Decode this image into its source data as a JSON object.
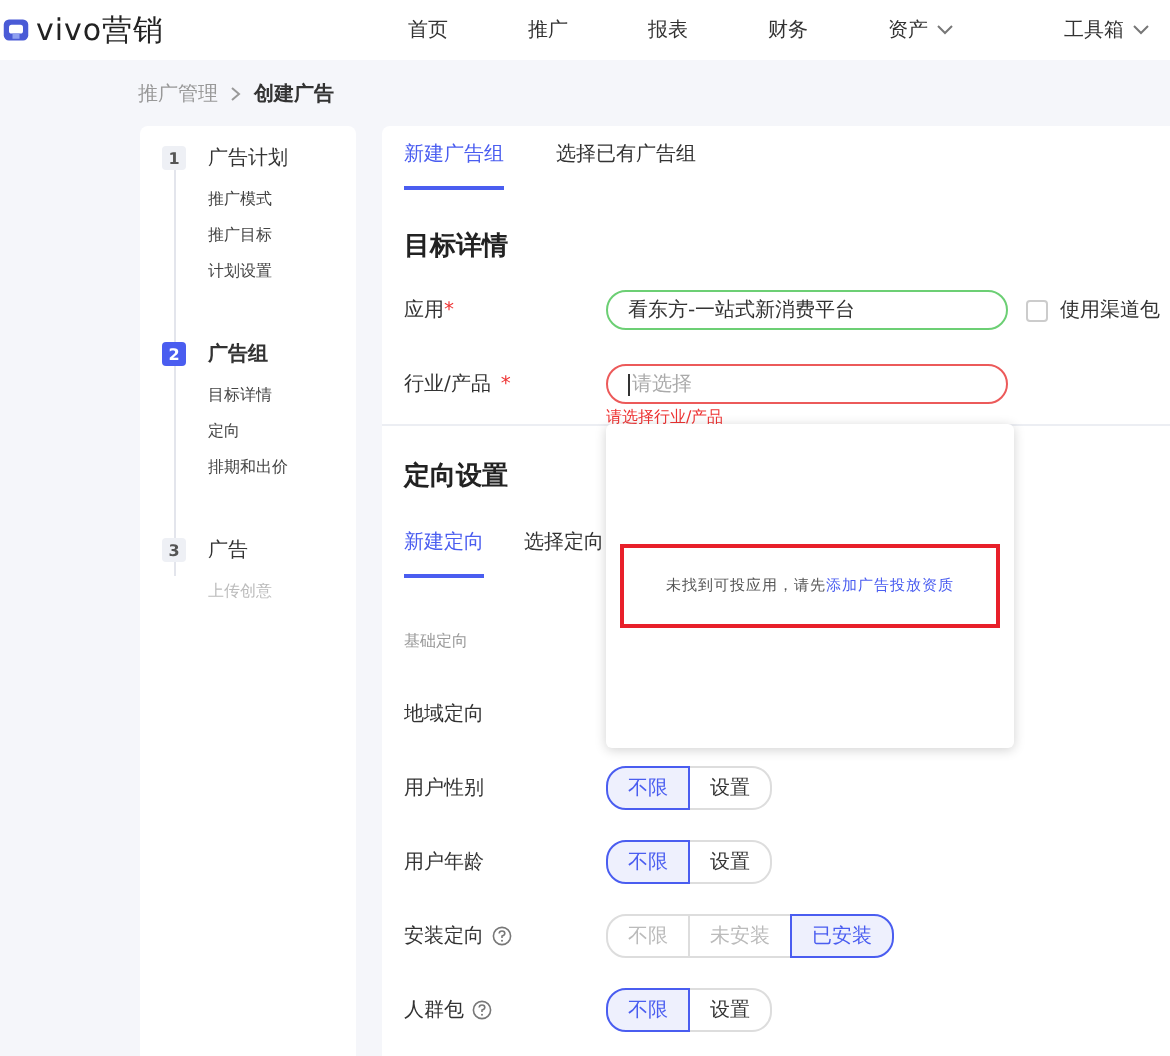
{
  "header": {
    "brand": "vivo营销",
    "nav": [
      {
        "label": "首页",
        "dropdown": false
      },
      {
        "label": "推广",
        "dropdown": false
      },
      {
        "label": "报表",
        "dropdown": false
      },
      {
        "label": "财务",
        "dropdown": false
      },
      {
        "label": "资产",
        "dropdown": true
      },
      {
        "label": "工具箱",
        "dropdown": true
      }
    ]
  },
  "breadcrumb": [
    {
      "label": "推广管理",
      "current": false
    },
    {
      "label": "创建广告",
      "current": true
    }
  ],
  "steps": [
    {
      "number": "1",
      "title": "广告计划",
      "active": false,
      "items": [
        {
          "label": "推广模式",
          "disabled": false
        },
        {
          "label": "推广目标",
          "disabled": false
        },
        {
          "label": "计划设置",
          "disabled": false
        }
      ]
    },
    {
      "number": "2",
      "title": "广告组",
      "active": true,
      "items": [
        {
          "label": "目标详情",
          "disabled": false
        },
        {
          "label": "定向",
          "disabled": false
        },
        {
          "label": "排期和出价",
          "disabled": false
        }
      ]
    },
    {
      "number": "3",
      "title": "广告",
      "active": false,
      "items": [
        {
          "label": "上传创意",
          "disabled": true
        }
      ]
    }
  ],
  "tabs": [
    {
      "label": "新建广告组",
      "selected": true
    },
    {
      "label": "选择已有广告组",
      "selected": false
    }
  ],
  "target_section": {
    "title": "目标详情",
    "fields": [
      {
        "label": "应用",
        "mark": "*",
        "value": "看东方-一站式新消费平台",
        "invalid": false,
        "checkbox": {
          "label": "使用渠道包",
          "checked": false
        }
      },
      {
        "label": "行业/产品",
        "mark": "*",
        "placeholder": "请选择",
        "invalid": true,
        "error": "请选择行业/产品"
      }
    ]
  },
  "dropdown": {
    "message": "未找到可投应用，请先",
    "link": "添加广告投放资质"
  },
  "targeting": {
    "title": "定向设置",
    "tabs": [
      {
        "label": "新建定向",
        "selected": true
      },
      {
        "label": "选择定向",
        "selected": false
      }
    ],
    "group": "基础定向",
    "rows": [
      {
        "label": "地域定向",
        "help": false
      },
      {
        "label": "用户性别",
        "help": false,
        "options": [
          {
            "label": "不限",
            "selected": true,
            "disabled": false
          },
          {
            "label": "设置",
            "selected": false,
            "disabled": false
          }
        ]
      },
      {
        "label": "用户年龄",
        "help": false,
        "options": [
          {
            "label": "不限",
            "selected": true,
            "disabled": false
          },
          {
            "label": "设置",
            "selected": false,
            "disabled": false
          }
        ]
      },
      {
        "label": "安装定向",
        "help": true,
        "options": [
          {
            "label": "不限",
            "selected": false,
            "disabled": true
          },
          {
            "label": "未安装",
            "selected": false,
            "disabled": true
          },
          {
            "label": "已安装",
            "selected": true,
            "disabled": false
          }
        ]
      },
      {
        "label": "人群包",
        "help": true,
        "options": [
          {
            "label": "不限",
            "selected": true,
            "disabled": false
          },
          {
            "label": "设置",
            "selected": false,
            "disabled": false
          }
        ]
      }
    ]
  }
}
